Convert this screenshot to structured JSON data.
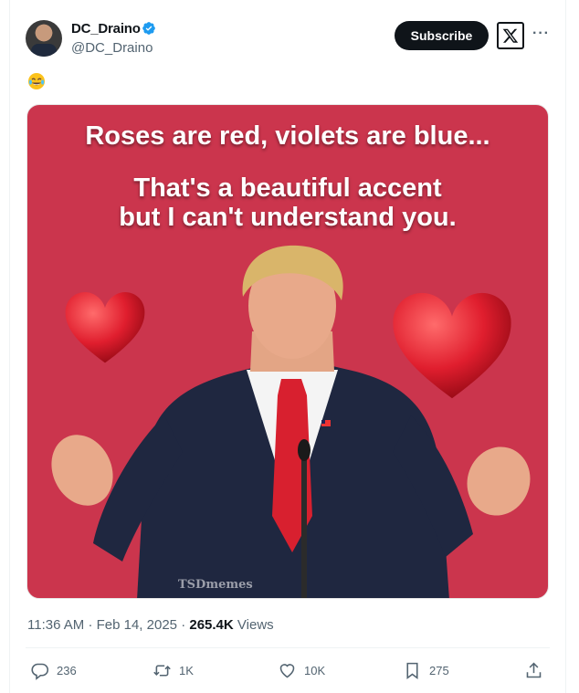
{
  "author": {
    "display_name": "DC_Draino",
    "handle": "@DC_Draino",
    "verified": true,
    "verified_color": "#1d9bf0"
  },
  "header": {
    "subscribe_label": "Subscribe",
    "more_label": "···"
  },
  "post": {
    "emoji": "face-with-tears-of-joy",
    "image": {
      "background_color": "#cb354d",
      "line1": "Roses are red, violets are blue...",
      "line2": "That's a beautiful accent",
      "line3": "but I can't understand you.",
      "watermark": "TSDmemes"
    }
  },
  "meta": {
    "time": "11:36 AM",
    "separator": "·",
    "date": "Feb 14, 2025",
    "views_count": "265.4K",
    "views_label": "Views"
  },
  "actions": {
    "replies": "236",
    "reposts": "1K",
    "likes": "10K",
    "bookmarks": "275"
  }
}
